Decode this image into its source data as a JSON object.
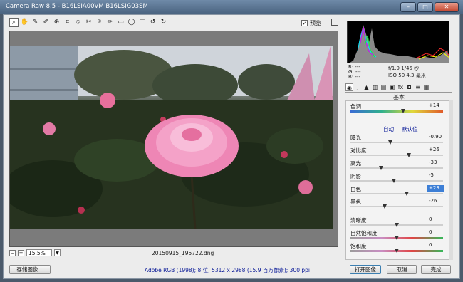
{
  "window": {
    "title": "Camera Raw 8.5 -  B16LSIA00VM B16LSIG03SM"
  },
  "toolbar": {
    "tools": [
      "zoom-tool",
      "hand-tool",
      "white-balance-tool",
      "color-sampler-tool",
      "target-adjust-tool",
      "crop-tool",
      "straighten-tool",
      "spot-removal-tool",
      "red-eye-tool",
      "adjustment-brush-tool",
      "graduated-filter-tool",
      "radial-filter-tool",
      "preferences-tool",
      "rotate-left-tool",
      "rotate-right-tool"
    ],
    "preview_label": "预览"
  },
  "canvas": {
    "zoom": "15.5%",
    "filename": "20150915_195722.dng"
  },
  "side": {
    "rgb": [
      "R: ---",
      "G: ---",
      "B: ---"
    ],
    "exif_line1": "f/1.9  1/45 秒",
    "exif_line2": "ISO 50  4.3 毫米",
    "panel_title": "基本",
    "auto_label": "自动",
    "default_label": "默认值",
    "rows": [
      {
        "label": "色调",
        "value": "+14",
        "track": "grad",
        "pos": 0.57
      },
      {
        "label": "曝光",
        "value": "-0.90",
        "track": "gray",
        "pos": 0.43
      },
      {
        "label": "对比度",
        "value": "+26",
        "track": "gray",
        "pos": 0.63
      },
      {
        "label": "高光",
        "value": "-33",
        "track": "gray",
        "pos": 0.33
      },
      {
        "label": "阴影",
        "value": "-5",
        "track": "gray",
        "pos": 0.47
      },
      {
        "label": "白色",
        "value": "+23",
        "track": "gray",
        "pos": 0.61,
        "active": true
      },
      {
        "label": "黑色",
        "value": "-26",
        "track": "gray",
        "pos": 0.37
      },
      {
        "label": "清晰度",
        "value": "0",
        "track": "gray",
        "pos": 0.5
      },
      {
        "label": "自然饱和度",
        "value": "0",
        "track": "sat",
        "pos": 0.5
      },
      {
        "label": "饱和度",
        "value": "0",
        "track": "sat",
        "pos": 0.5
      }
    ]
  },
  "bottom": {
    "save_label": "存储图像...",
    "workflow_link": "Adobe RGB (1998); 8 位; 5312 x 2988 (15.9 百万像素); 300 ppi",
    "open_label": "打开图像",
    "cancel_label": "取消",
    "done_label": "完成"
  }
}
